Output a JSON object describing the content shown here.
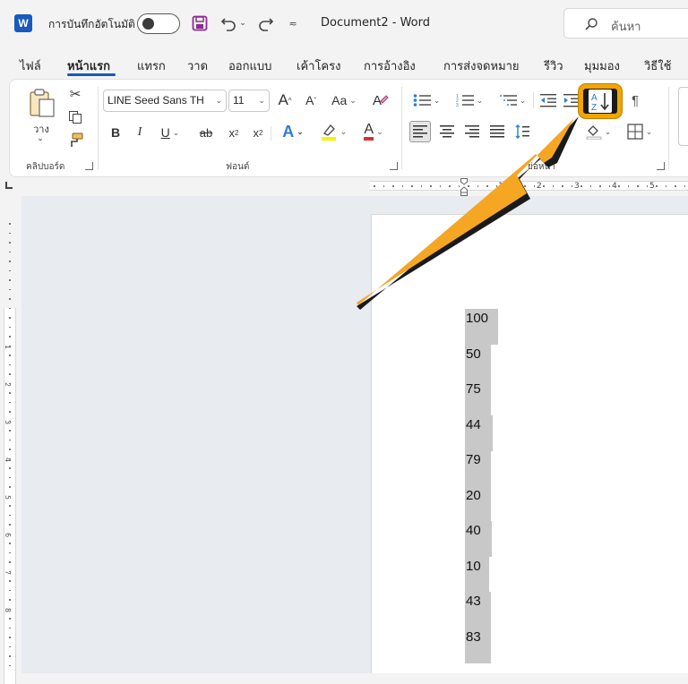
{
  "titlebar": {
    "app_icon_letter": "W",
    "autosave_label": "การบันทึกอัตโนมัติ",
    "document_title": "Document2  -  Word",
    "search_placeholder": "ค้นหา"
  },
  "tabs": [
    "ไฟล์",
    "หน้าแรก",
    "แทรก",
    "วาด",
    "ออกแบบ",
    "เค้าโครง",
    "การอ้างอิง",
    "การส่งจดหมาย",
    "รีวิว",
    "มุมมอง",
    "วิธีใช้"
  ],
  "active_tab": "หน้าแรก",
  "ribbon": {
    "clipboard": {
      "paste_label": "วาง",
      "group_label": "คลิปบอร์ด"
    },
    "font": {
      "font_name": "LINE Seed Sans TH",
      "font_size": "11",
      "grow_label": "A",
      "shrink_label": "A",
      "case_label": "Aa",
      "bold_label": "B",
      "italic_label": "I",
      "underline_label": "U",
      "strike_label": "ab",
      "subscript_label": "x",
      "superscript_label": "x",
      "effects_label": "A",
      "color_label": "A",
      "group_label": "ฟอนต์"
    },
    "paragraph": {
      "group_label": "ย่อหน้า"
    }
  },
  "ruler": {
    "numbers": [
      "1",
      "2",
      "3",
      "4",
      "5"
    ],
    "vertical_numbers": [
      "1",
      "2",
      "3",
      "4",
      "5",
      "6",
      "7",
      "8"
    ]
  },
  "document": {
    "lines": [
      "100",
      "50",
      "75",
      "44",
      "79",
      "20",
      "40",
      "10",
      "43",
      "83"
    ]
  },
  "colors": {
    "accent": "#185abd",
    "highlight_box": "#f0a500",
    "arrow": "#f39c12",
    "selection": "#c8c8c8"
  },
  "icons": {
    "sort": "sort-az-icon",
    "search": "search-icon",
    "save": "save-icon",
    "undo": "undo-icon",
    "redo": "redo-icon"
  }
}
